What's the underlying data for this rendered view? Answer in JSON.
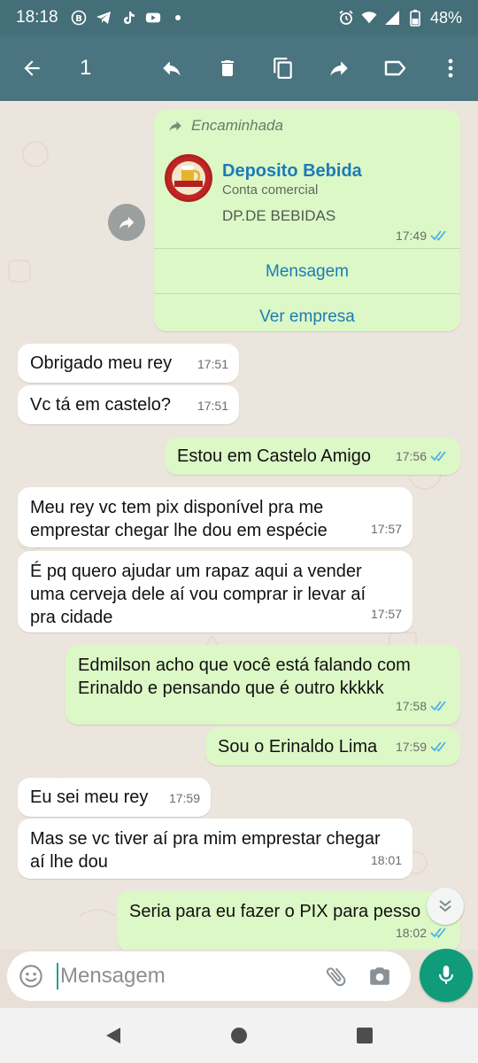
{
  "status_bar": {
    "time": "18:18",
    "battery": "48%",
    "icons_left": [
      "b-icon",
      "telegram-icon",
      "tiktok-icon",
      "youtube-icon",
      "dot-icon"
    ],
    "icons_right": [
      "alarm-icon",
      "wifi-icon",
      "signal-icon",
      "battery-icon"
    ]
  },
  "action_bar": {
    "selected_count": "1",
    "actions": [
      "reply-icon",
      "delete-icon",
      "copy-icon",
      "forward-icon",
      "label-icon",
      "more-icon"
    ]
  },
  "forwarded": {
    "label": "Encaminhada",
    "business_name": "Deposito Bebida",
    "business_type": "Conta comercial",
    "description": "DP.DE BEBIDAS",
    "time": "17:49",
    "action_message": "Mensagem",
    "action_company": "Ver empresa"
  },
  "messages": [
    {
      "dir": "in",
      "text": "Obrigado meu rey",
      "time": "17:51"
    },
    {
      "dir": "in",
      "text": "Vc tá em castelo?",
      "time": "17:51"
    },
    {
      "dir": "out",
      "text": "Estou em Castelo Amigo",
      "time": "17:56"
    },
    {
      "dir": "in",
      "text": "Meu rey vc tem pix disponível pra me emprestar chegar lhe dou em espécie",
      "time": "17:57"
    },
    {
      "dir": "in",
      "text": "É pq quero ajudar um rapaz aqui a vender uma cerveja dele aí vou comprar ir levar aí pra cidade",
      "time": "17:57"
    },
    {
      "dir": "out",
      "text": "Edmilson acho que você está falando com Erinaldo e pensando que é outro kkkkk",
      "time": "17:58"
    },
    {
      "dir": "out",
      "text": "Sou o Erinaldo Lima",
      "time": "17:59"
    },
    {
      "dir": "in",
      "text": "Eu sei meu rey",
      "time": "17:59"
    },
    {
      "dir": "in",
      "text": "Mas se vc tiver aí pra mim emprestar chegar aí lhe dou",
      "time": "18:01"
    },
    {
      "dir": "out",
      "text": "Seria para eu fazer o PIX para pesso",
      "time": "18:02"
    }
  ],
  "input": {
    "placeholder": "Mensagem"
  },
  "colors": {
    "header": "#4a747f",
    "outgoing_bubble": "#dcf8c6",
    "incoming_bubble": "#ffffff",
    "link": "#1b7bb8",
    "read_ticks": "#4fb0e6",
    "mic_button": "#109b7b"
  }
}
